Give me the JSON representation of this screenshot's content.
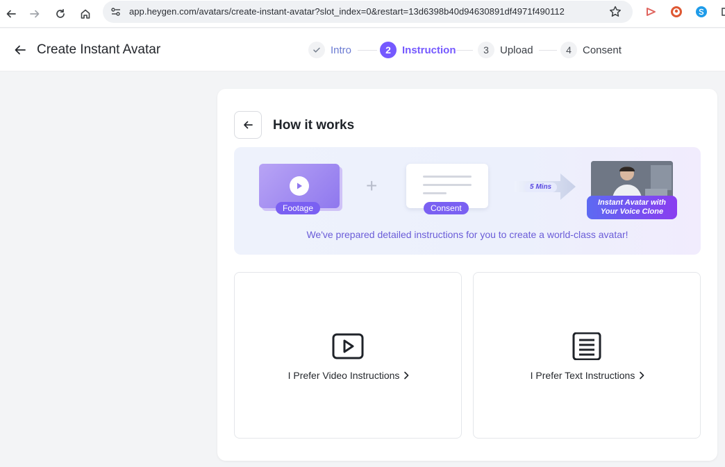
{
  "browser": {
    "url": "app.heygen.com/avatars/create-instant-avatar?slot_index=0&restart=13d6398b40d94630891df4971f490112"
  },
  "header": {
    "title": "Create Instant Avatar",
    "steps": [
      {
        "number": "",
        "label": "Intro",
        "state": "done"
      },
      {
        "number": "2",
        "label": "Instruction",
        "state": "active"
      },
      {
        "number": "3",
        "label": "Upload",
        "state": "todo"
      },
      {
        "number": "4",
        "label": "Consent",
        "state": "todo"
      }
    ]
  },
  "card": {
    "title": "How it works",
    "banner": {
      "footage_label": "Footage",
      "consent_label": "Consent",
      "time_label": "5 Mins",
      "result_label_line1": "Instant Avatar with",
      "result_label_line2": "Your Voice Clone",
      "caption": "We've prepared detailed instructions for you to create a world-class avatar!"
    },
    "options": [
      {
        "label": "I Prefer Video Instructions",
        "icon": "video-play-icon"
      },
      {
        "label": "I Prefer Text Instructions",
        "icon": "text-document-icon"
      }
    ]
  },
  "colors": {
    "accent": "#7559ff",
    "caption": "#6a5cd8",
    "banner_bg": "#eef2fc"
  }
}
